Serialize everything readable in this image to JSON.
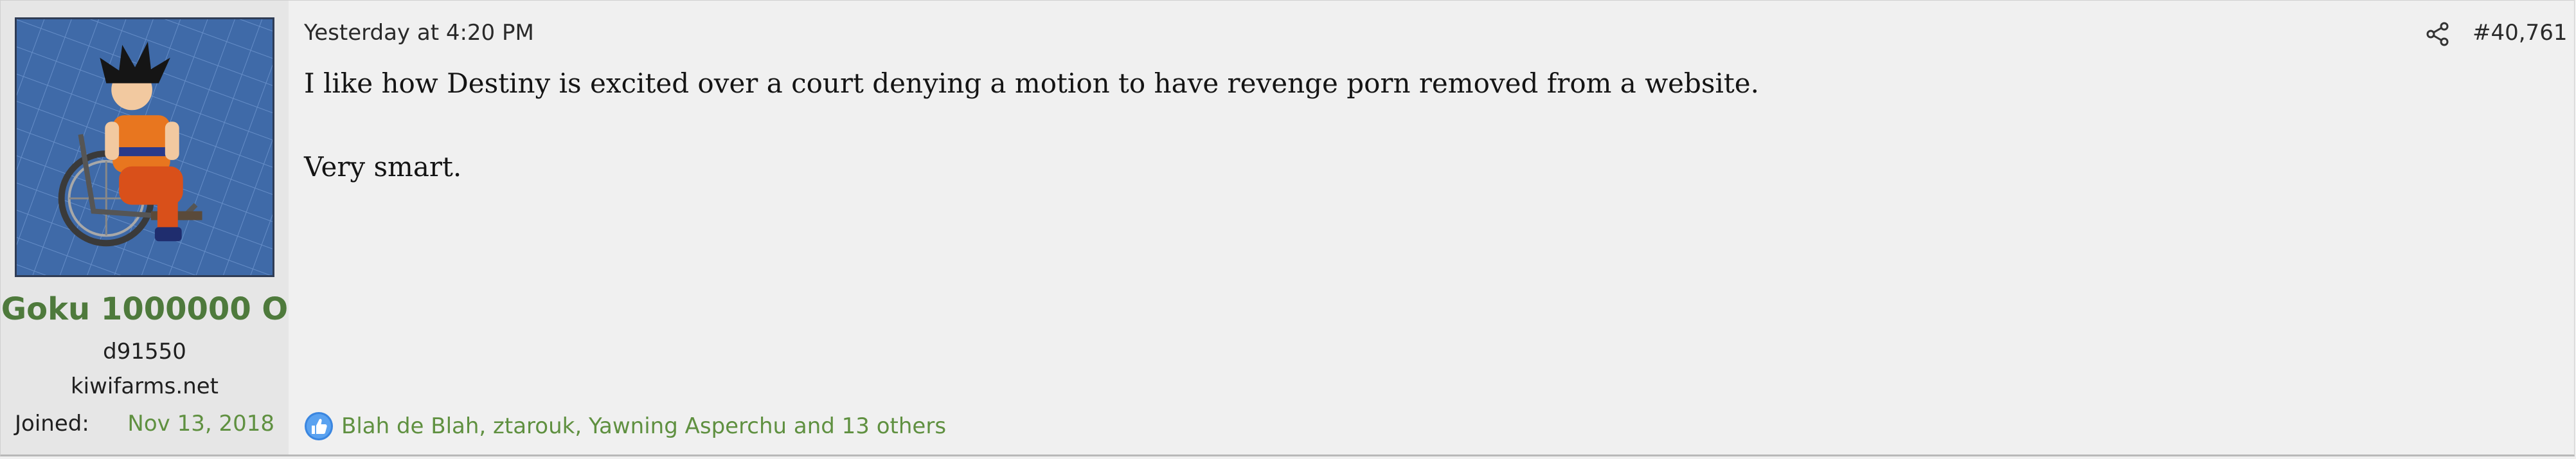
{
  "user": {
    "avatar_icon": "goku-wheelchair-avatar-icon",
    "username": "Goku 1000000 O",
    "title_line1": "d91550",
    "title_line2": "kiwifarms.net",
    "joined_label": "Joined:",
    "joined_date": "Nov 13, 2018"
  },
  "post": {
    "timestamp": "Yesterday at 4:20 PM",
    "share_icon": "share-icon",
    "number": "#40,761",
    "message_line1": "I like how Destiny is excited over a court denying a motion to have revenge porn removed from a website.",
    "message_line2": "Very smart."
  },
  "reactions": {
    "icon": "like-icon",
    "text": "Blah de Blah, ztarouk, Yawning Asperchu and 13 others"
  },
  "colors": {
    "username": "#4e7a3c",
    "link": "#5f9040",
    "background": "#f0f0f0",
    "user_cell": "#e6e6e6",
    "avatar_bg": "#3f6aa8"
  }
}
